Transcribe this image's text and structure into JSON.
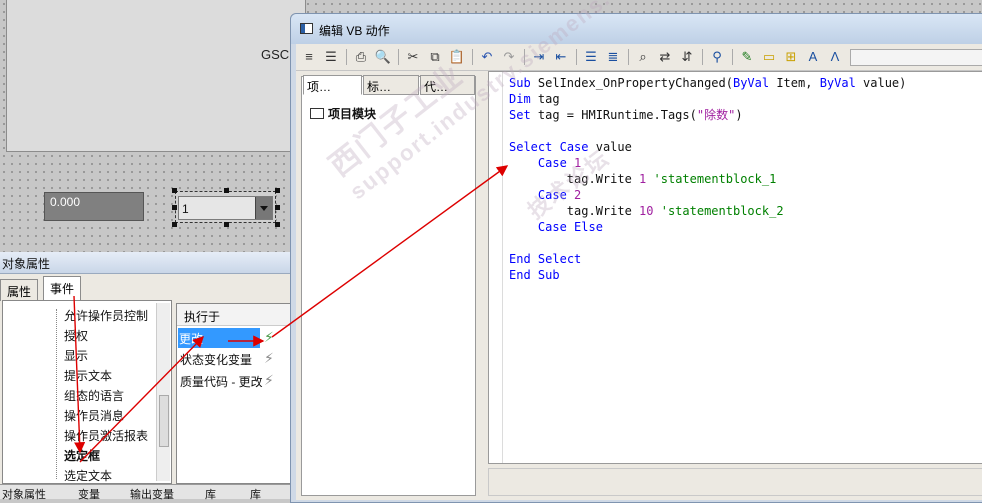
{
  "background": {
    "screen_label": "GSC",
    "io_field_value": "0.000",
    "combo_value": "1"
  },
  "properties_panel": {
    "title": "对象属性",
    "tabs": [
      "属性",
      "事件"
    ],
    "tree_items": [
      "允许操作员控制",
      "授权",
      "显示",
      "提示文本",
      "组态的语言",
      "操作员消息",
      "操作员激活报表",
      "选定框",
      "选定文本"
    ],
    "events_header": "执行于",
    "events": [
      "更改",
      "状态变化变量",
      "质量代码 - 更改"
    ],
    "bottom_tabs": [
      "对象属性",
      "变量",
      "输出变量",
      "库",
      "库"
    ]
  },
  "vb_dialog": {
    "title": "编辑 VB 动作",
    "left_tabs": [
      "项…",
      "标…",
      "代…"
    ],
    "tree_root": "项目模块",
    "code": {
      "line1": {
        "kw1": "Sub",
        "name": " SelIndex_OnPropertyChanged(",
        "kw2": "ByVal",
        "p1": " Item, ",
        "kw3": "ByVal",
        "p2": " value)"
      },
      "line2": {
        "kw": "Dim",
        "rest": " tag"
      },
      "line3": {
        "kw": "Set",
        "rest": " tag = HMIRuntime.Tags(",
        "str": "\"除数\"",
        "end": ")"
      },
      "line5": {
        "kw1": "Select",
        "kw2": "Case",
        "rest": " value"
      },
      "line6": {
        "kw": "Case",
        "num": "1"
      },
      "line7": {
        "pre": "tag.Write ",
        "num": "1",
        "cmt": "'statementblock_1"
      },
      "line8": {
        "kw": "Case",
        "num": "2"
      },
      "line9": {
        "pre": "tag.Write ",
        "num": "10",
        "cmt": "'statementblock_2"
      },
      "line10": {
        "kw1": "Case",
        "kw2": "Else"
      },
      "line12": {
        "kw1": "End",
        "kw2": "Select"
      },
      "line13": {
        "kw1": "End",
        "kw2": "Sub"
      }
    }
  },
  "watermark": {
    "line1": "西门子工业",
    "line2": "support.industry.siemens.com/cs",
    "line3": "技术论坛"
  },
  "colors": {
    "keyword": "#0000ff",
    "string": "#a020a0",
    "comment": "#008000",
    "arrow": "#dd0000",
    "selection": "#3399ff"
  }
}
